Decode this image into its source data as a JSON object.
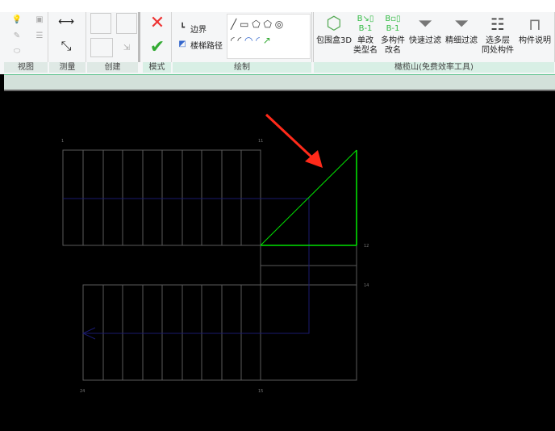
{
  "ribbon": {
    "panels": [
      "视图",
      "测量",
      "创建",
      "模式",
      "绘制",
      "橄榄山(免费效率工具)"
    ],
    "mode": {
      "boundary": "边界",
      "stair_path": "楼梯路径"
    },
    "tools": [
      {
        "l1": "包围盒3D",
        "l2": ""
      },
      {
        "l1": "单改",
        "l2": "类型名"
      },
      {
        "l1": "多构件",
        "l2": "改名"
      },
      {
        "l1": "快速过滤",
        "l2": ""
      },
      {
        "l1": "精细过滤",
        "l2": ""
      },
      {
        "l1": "选多层",
        "l2": "同处构件"
      },
      {
        "l1": "构件说明",
        "l2": ""
      }
    ]
  },
  "drawing": {
    "labels": [
      "1",
      "11",
      "12",
      "14",
      "24",
      "15"
    ],
    "colors": {
      "lines": "#5a5a5a",
      "boundary": "#00e000",
      "path": "#1a1a6e",
      "arrow": "#ff2a1a"
    }
  }
}
